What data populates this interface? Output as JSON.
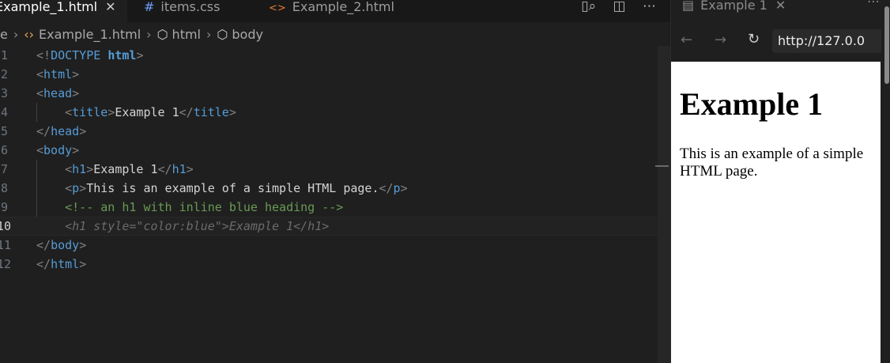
{
  "editor": {
    "tabs": [
      {
        "label": "Example_1.html",
        "icon": "",
        "active": true
      },
      {
        "label": "items.css",
        "icon": "#"
      },
      {
        "label": "Example_2.html",
        "icon": "<>"
      }
    ],
    "tab_actions": [
      "open-changes-icon",
      "split-editor-icon",
      "more-actions-icon"
    ],
    "breadcrumb": [
      "e",
      "Example_1.html",
      "html",
      "body"
    ],
    "line_numbers": [
      "1",
      "2",
      "3",
      "4",
      "5",
      "6",
      "7",
      "8",
      "9",
      "10",
      "11",
      "12"
    ],
    "lines": [
      "<!DOCTYPE html>",
      "<html>",
      "<head>",
      "    <title>Example 1</title>",
      "</head>",
      "<body>",
      "    <h1>Example 1</h1>",
      "    <p>This is an example of a simple HTML page.</p>",
      "    <!-- an h1 with inline blue heading -->",
      "    <h1 style=\"color:blue\">Example 1</h1>",
      "</body>",
      "</html>"
    ],
    "current_line": 10,
    "colors": {
      "tag": "#569cd6",
      "comment": "#6a9955",
      "text": "#d4d4d4",
      "line_number": "#6e7681"
    }
  },
  "browser": {
    "tab_title": "Example 1",
    "url": "http://127.0.0",
    "page": {
      "heading": "Example 1",
      "paragraph": "This is an example of a simple HTML page."
    }
  }
}
